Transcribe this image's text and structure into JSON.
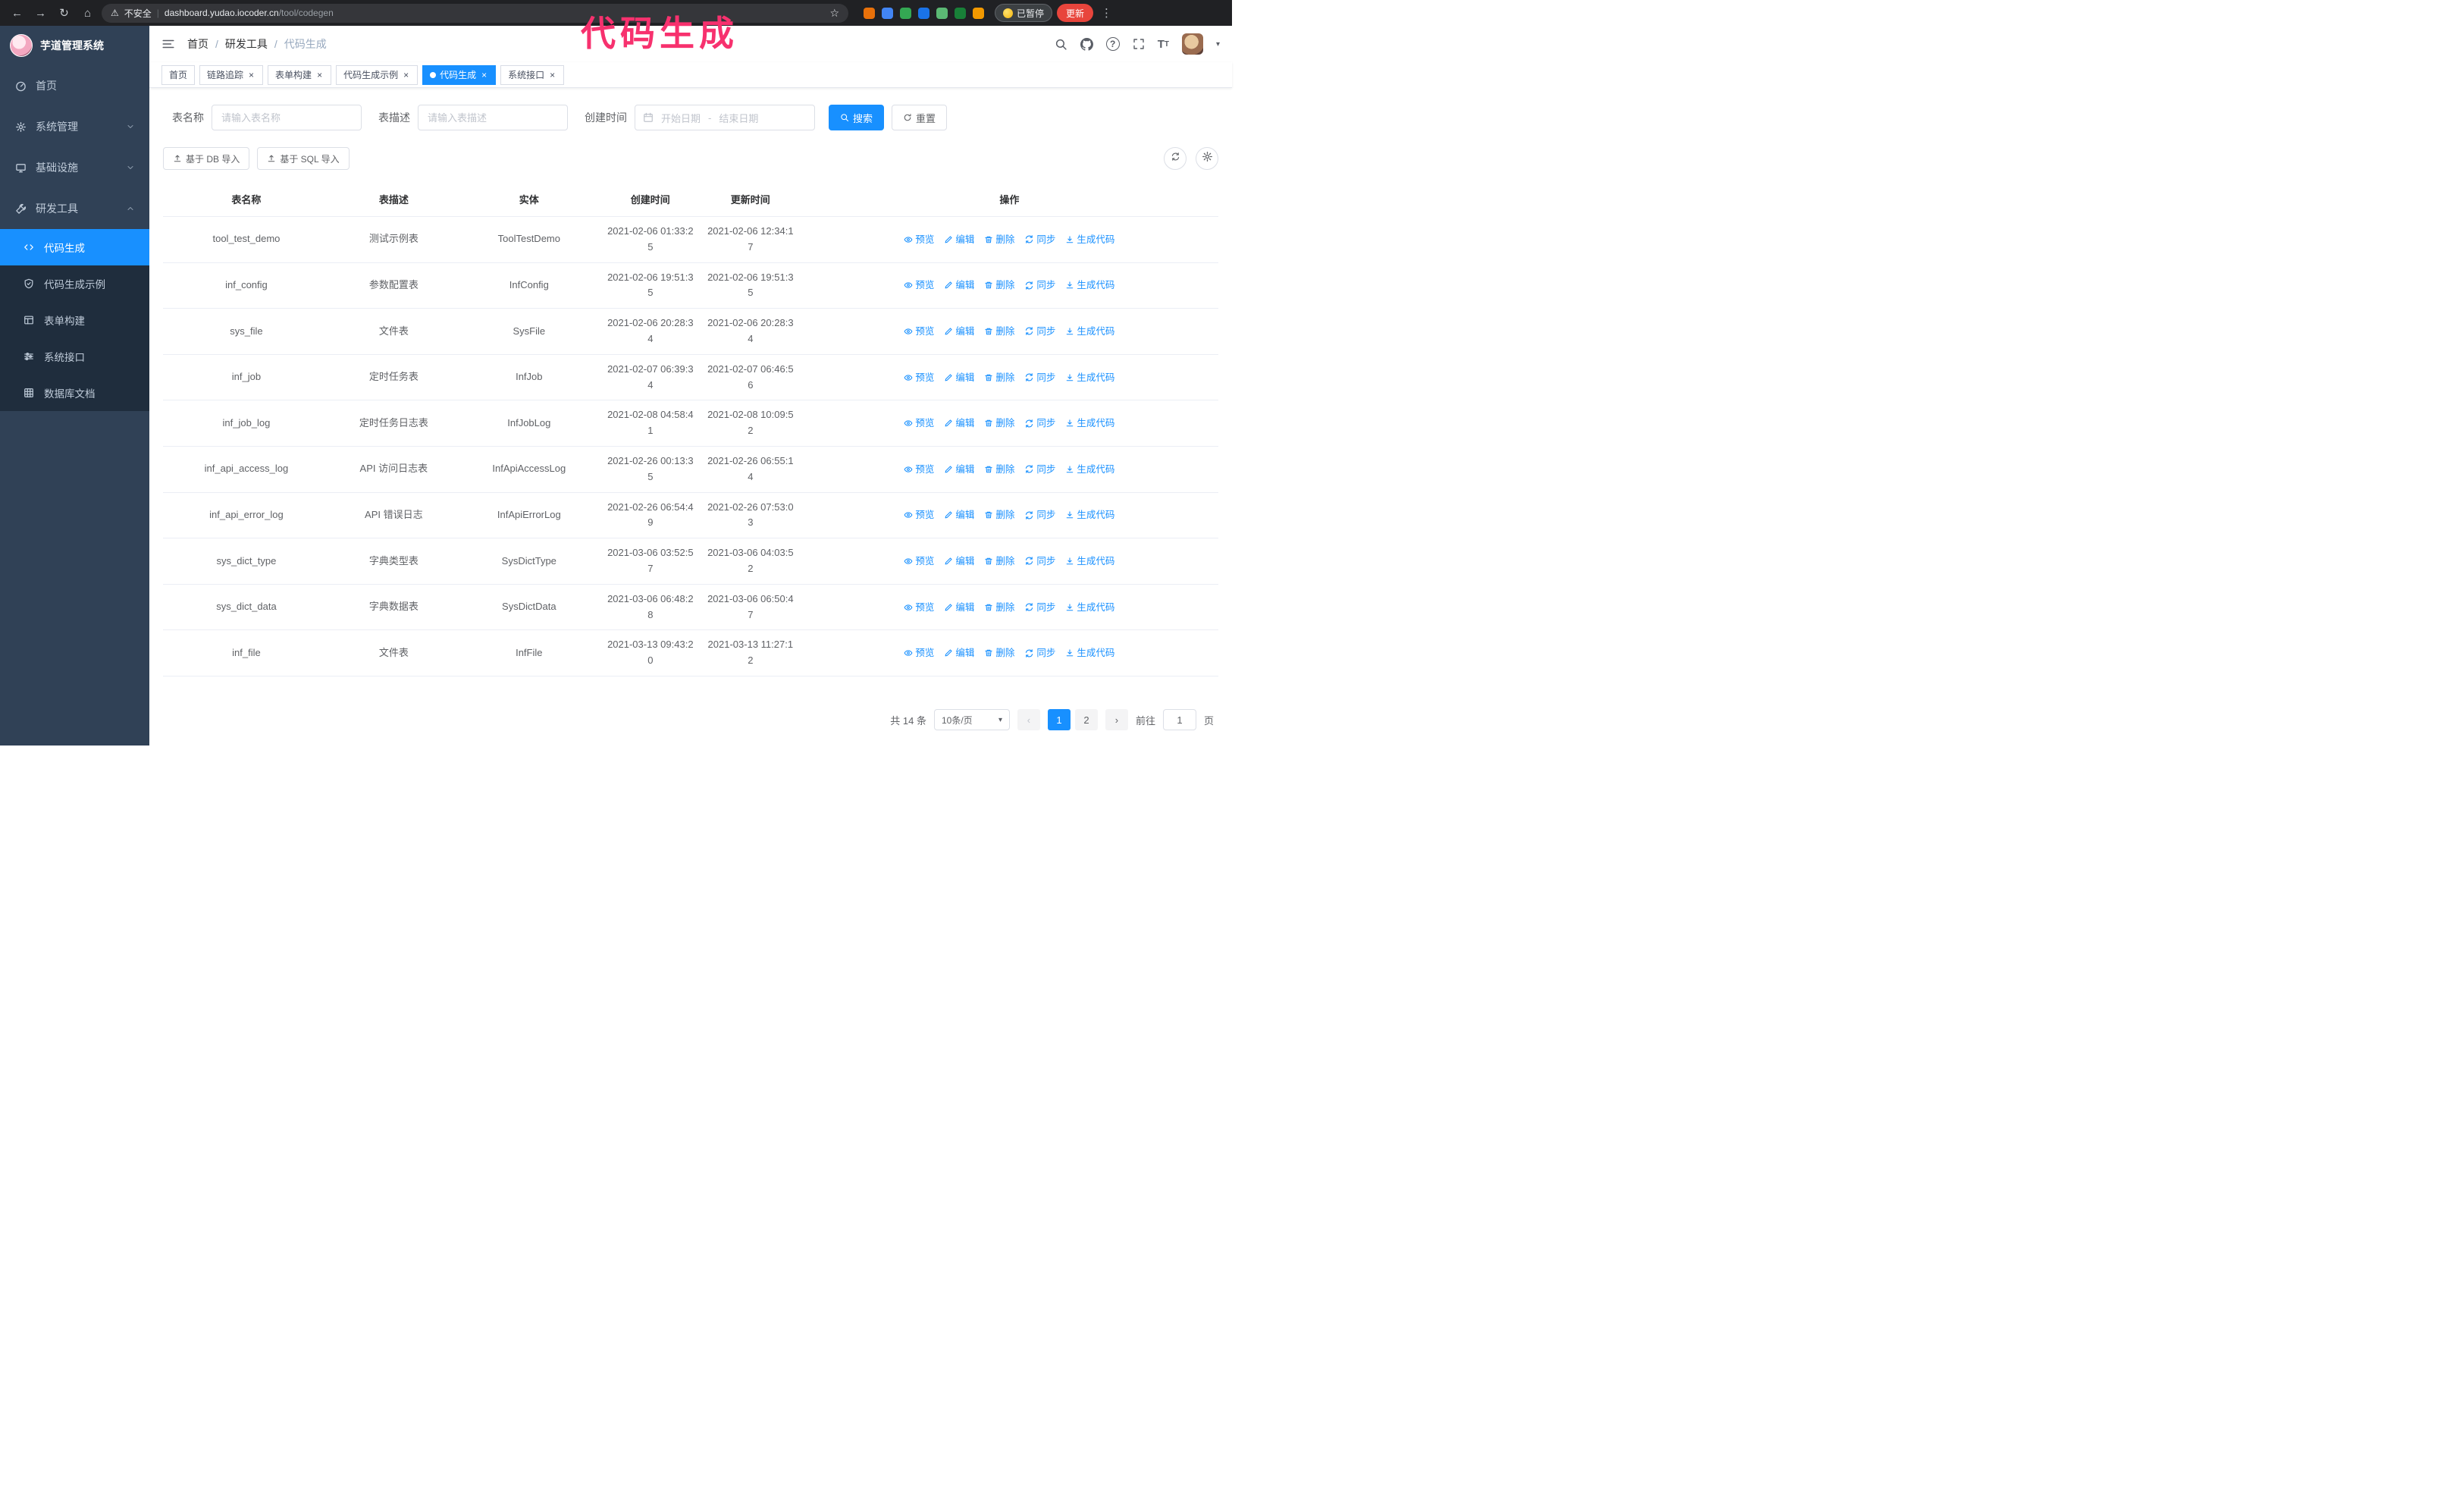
{
  "colors": {
    "accent": "#1890ff",
    "sidebar_bg": "#304156",
    "submenu_bg": "#1f2d3d",
    "annotation": "#f7316e",
    "update_button_bg": "#e8453c",
    "browser_bar_bg": "#202124"
  },
  "annotation": {
    "text": "代码生成"
  },
  "browser": {
    "security_warning": "不安全",
    "url_host": "dashboard.yudao.iocoder.cn",
    "url_path": "/tool/codegen",
    "paused_badge": "已暂停",
    "update_button": "更新",
    "extensions": [
      "#e8710a",
      "#4285f4",
      "#34a853",
      "#1a73e8",
      "#5bb974",
      "#188038",
      "#f29900"
    ]
  },
  "sidebar": {
    "title": "芋道管理系统",
    "items": [
      {
        "label": "首页",
        "icon": "dashboard-icon"
      },
      {
        "label": "系统管理",
        "icon": "gear-icon",
        "chevron": "down"
      },
      {
        "label": "基础设施",
        "icon": "monitor-icon",
        "chevron": "down"
      },
      {
        "label": "研发工具",
        "icon": "tools-icon",
        "chevron": "up",
        "expanded": true
      }
    ],
    "subitems": [
      {
        "label": "代码生成",
        "icon": "code-icon",
        "active": true
      },
      {
        "label": "代码生成示例",
        "icon": "shield-icon"
      },
      {
        "label": "表单构建",
        "icon": "form-icon"
      },
      {
        "label": "系统接口",
        "icon": "sliders-icon"
      },
      {
        "label": "数据库文档",
        "icon": "grid-icon"
      }
    ]
  },
  "header": {
    "breadcrumb": [
      "首页",
      "研发工具",
      "代码生成"
    ],
    "separator": "/"
  },
  "tags": [
    {
      "label": "首页"
    },
    {
      "label": "链路追踪",
      "closable": true
    },
    {
      "label": "表单构建",
      "closable": true
    },
    {
      "label": "代码生成示例",
      "closable": true
    },
    {
      "label": "代码生成",
      "closable": true,
      "active": true
    },
    {
      "label": "系统接口",
      "closable": true
    }
  ],
  "filters": {
    "table_name_label": "表名称",
    "table_name_placeholder": "请输入表名称",
    "table_desc_label": "表描述",
    "table_desc_placeholder": "请输入表描述",
    "create_time_label": "创建时间",
    "date_start_placeholder": "开始日期",
    "date_separator": "-",
    "date_end_placeholder": "结束日期",
    "search_button": "搜索",
    "reset_button": "重置"
  },
  "toolbar": {
    "import_db": "基于 DB 导入",
    "import_sql": "基于 SQL 导入"
  },
  "table": {
    "columns": [
      "表名称",
      "表描述",
      "实体",
      "创建时间",
      "更新时间",
      "操作"
    ],
    "actions": [
      {
        "label": "预览",
        "icon": "eye-icon",
        "name": "preview"
      },
      {
        "label": "编辑",
        "icon": "edit-icon",
        "name": "edit"
      },
      {
        "label": "删除",
        "icon": "delete-icon",
        "name": "delete"
      },
      {
        "label": "同步",
        "icon": "sync-icon",
        "name": "sync"
      },
      {
        "label": "生成代码",
        "icon": "download-icon",
        "name": "generate"
      }
    ],
    "rows": [
      {
        "name": "tool_test_demo",
        "desc": "测试示例表",
        "entity": "ToolTestDemo",
        "created": "2021-02-06 01:33:25",
        "updated": "2021-02-06 12:34:17"
      },
      {
        "name": "inf_config",
        "desc": "参数配置表",
        "entity": "InfConfig",
        "created": "2021-02-06 19:51:35",
        "updated": "2021-02-06 19:51:35"
      },
      {
        "name": "sys_file",
        "desc": "文件表",
        "entity": "SysFile",
        "created": "2021-02-06 20:28:34",
        "updated": "2021-02-06 20:28:34"
      },
      {
        "name": "inf_job",
        "desc": "定时任务表",
        "entity": "InfJob",
        "created": "2021-02-07 06:39:34",
        "updated": "2021-02-07 06:46:56"
      },
      {
        "name": "inf_job_log",
        "desc": "定时任务日志表",
        "entity": "InfJobLog",
        "created": "2021-02-08 04:58:41",
        "updated": "2021-02-08 10:09:52"
      },
      {
        "name": "inf_api_access_log",
        "desc": "API 访问日志表",
        "entity": "InfApiAccessLog",
        "created": "2021-02-26 00:13:35",
        "updated": "2021-02-26 06:55:14"
      },
      {
        "name": "inf_api_error_log",
        "desc": "API 错误日志",
        "entity": "InfApiErrorLog",
        "created": "2021-02-26 06:54:49",
        "updated": "2021-02-26 07:53:03"
      },
      {
        "name": "sys_dict_type",
        "desc": "字典类型表",
        "entity": "SysDictType",
        "created": "2021-03-06 03:52:57",
        "updated": "2021-03-06 04:03:52"
      },
      {
        "name": "sys_dict_data",
        "desc": "字典数据表",
        "entity": "SysDictData",
        "created": "2021-03-06 06:48:28",
        "updated": "2021-03-06 06:50:47"
      },
      {
        "name": "inf_file",
        "desc": "文件表",
        "entity": "InfFile",
        "created": "2021-03-13 09:43:20",
        "updated": "2021-03-13 11:27:12"
      }
    ]
  },
  "pagination": {
    "total": "共 14 条",
    "page_size": "10条/页",
    "pages": [
      {
        "label": "1",
        "active": true
      },
      {
        "label": "2"
      }
    ],
    "prev": "‹",
    "next": "›",
    "goto_label": "前往",
    "goto_value": "1",
    "page_label": "页"
  }
}
